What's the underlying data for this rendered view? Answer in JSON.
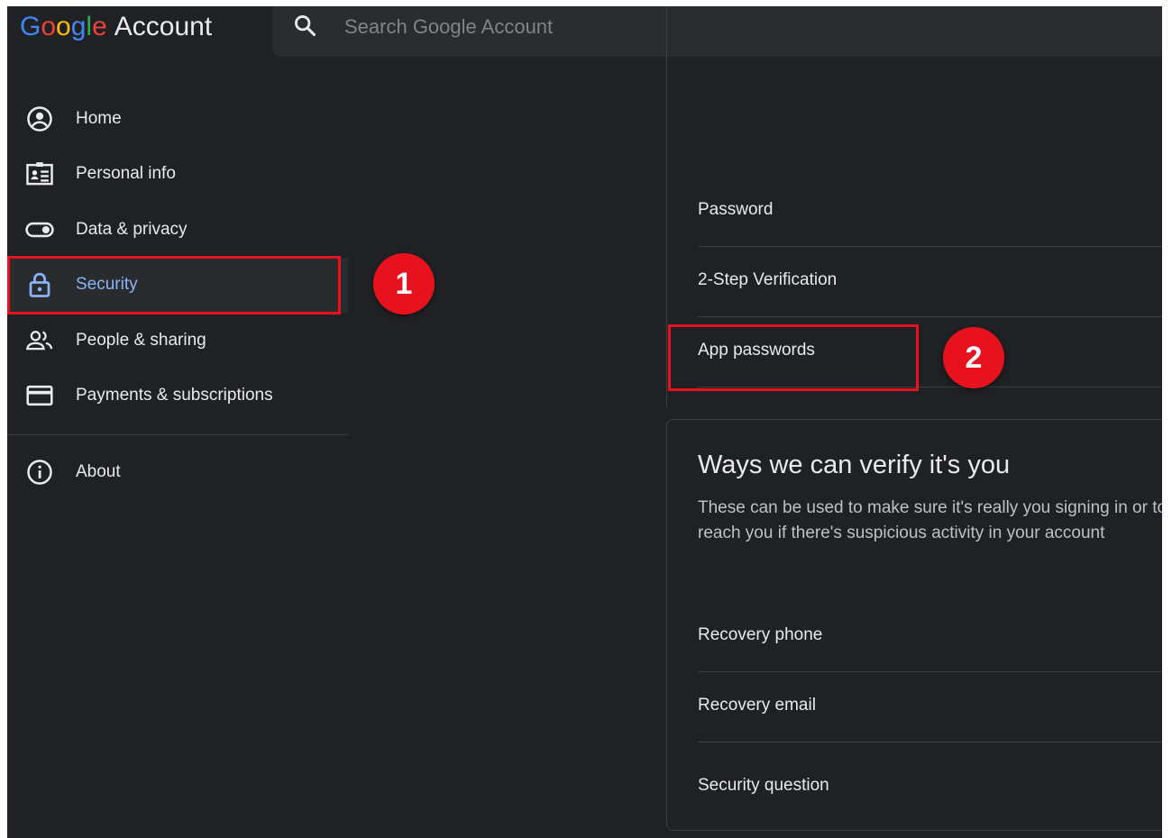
{
  "header": {
    "logo_google": [
      "G",
      "o",
      "o",
      "g",
      "l",
      "e"
    ],
    "logo_account": "Account",
    "search_placeholder": "Search Google Account"
  },
  "sidebar": {
    "items": [
      {
        "label": "Home",
        "icon": "account-circle-icon"
      },
      {
        "label": "Personal info",
        "icon": "id-card-icon"
      },
      {
        "label": "Data & privacy",
        "icon": "toggle-icon"
      },
      {
        "label": "Security",
        "icon": "lock-icon",
        "active": true
      },
      {
        "label": "People & sharing",
        "icon": "people-icon"
      },
      {
        "label": "Payments & subscriptions",
        "icon": "credit-card-icon"
      }
    ],
    "about": {
      "label": "About",
      "icon": "info-icon"
    }
  },
  "annotations": {
    "step1": "1",
    "step2": "2",
    "color": "#e8121f"
  },
  "signing_in": {
    "rows": [
      "Password",
      "2-Step Verification",
      "App passwords"
    ]
  },
  "verify": {
    "title": "Ways we can verify it's you",
    "description": "These can be used to make sure it's really you signing in or to reach you if there's suspicious activity in your account",
    "rows": [
      "Recovery phone",
      "Recovery email",
      "Security question"
    ]
  },
  "colors": {
    "background": "#202124",
    "text": "#e8eaed",
    "accent": "#8ab4f8",
    "divider": "#3c4043"
  }
}
